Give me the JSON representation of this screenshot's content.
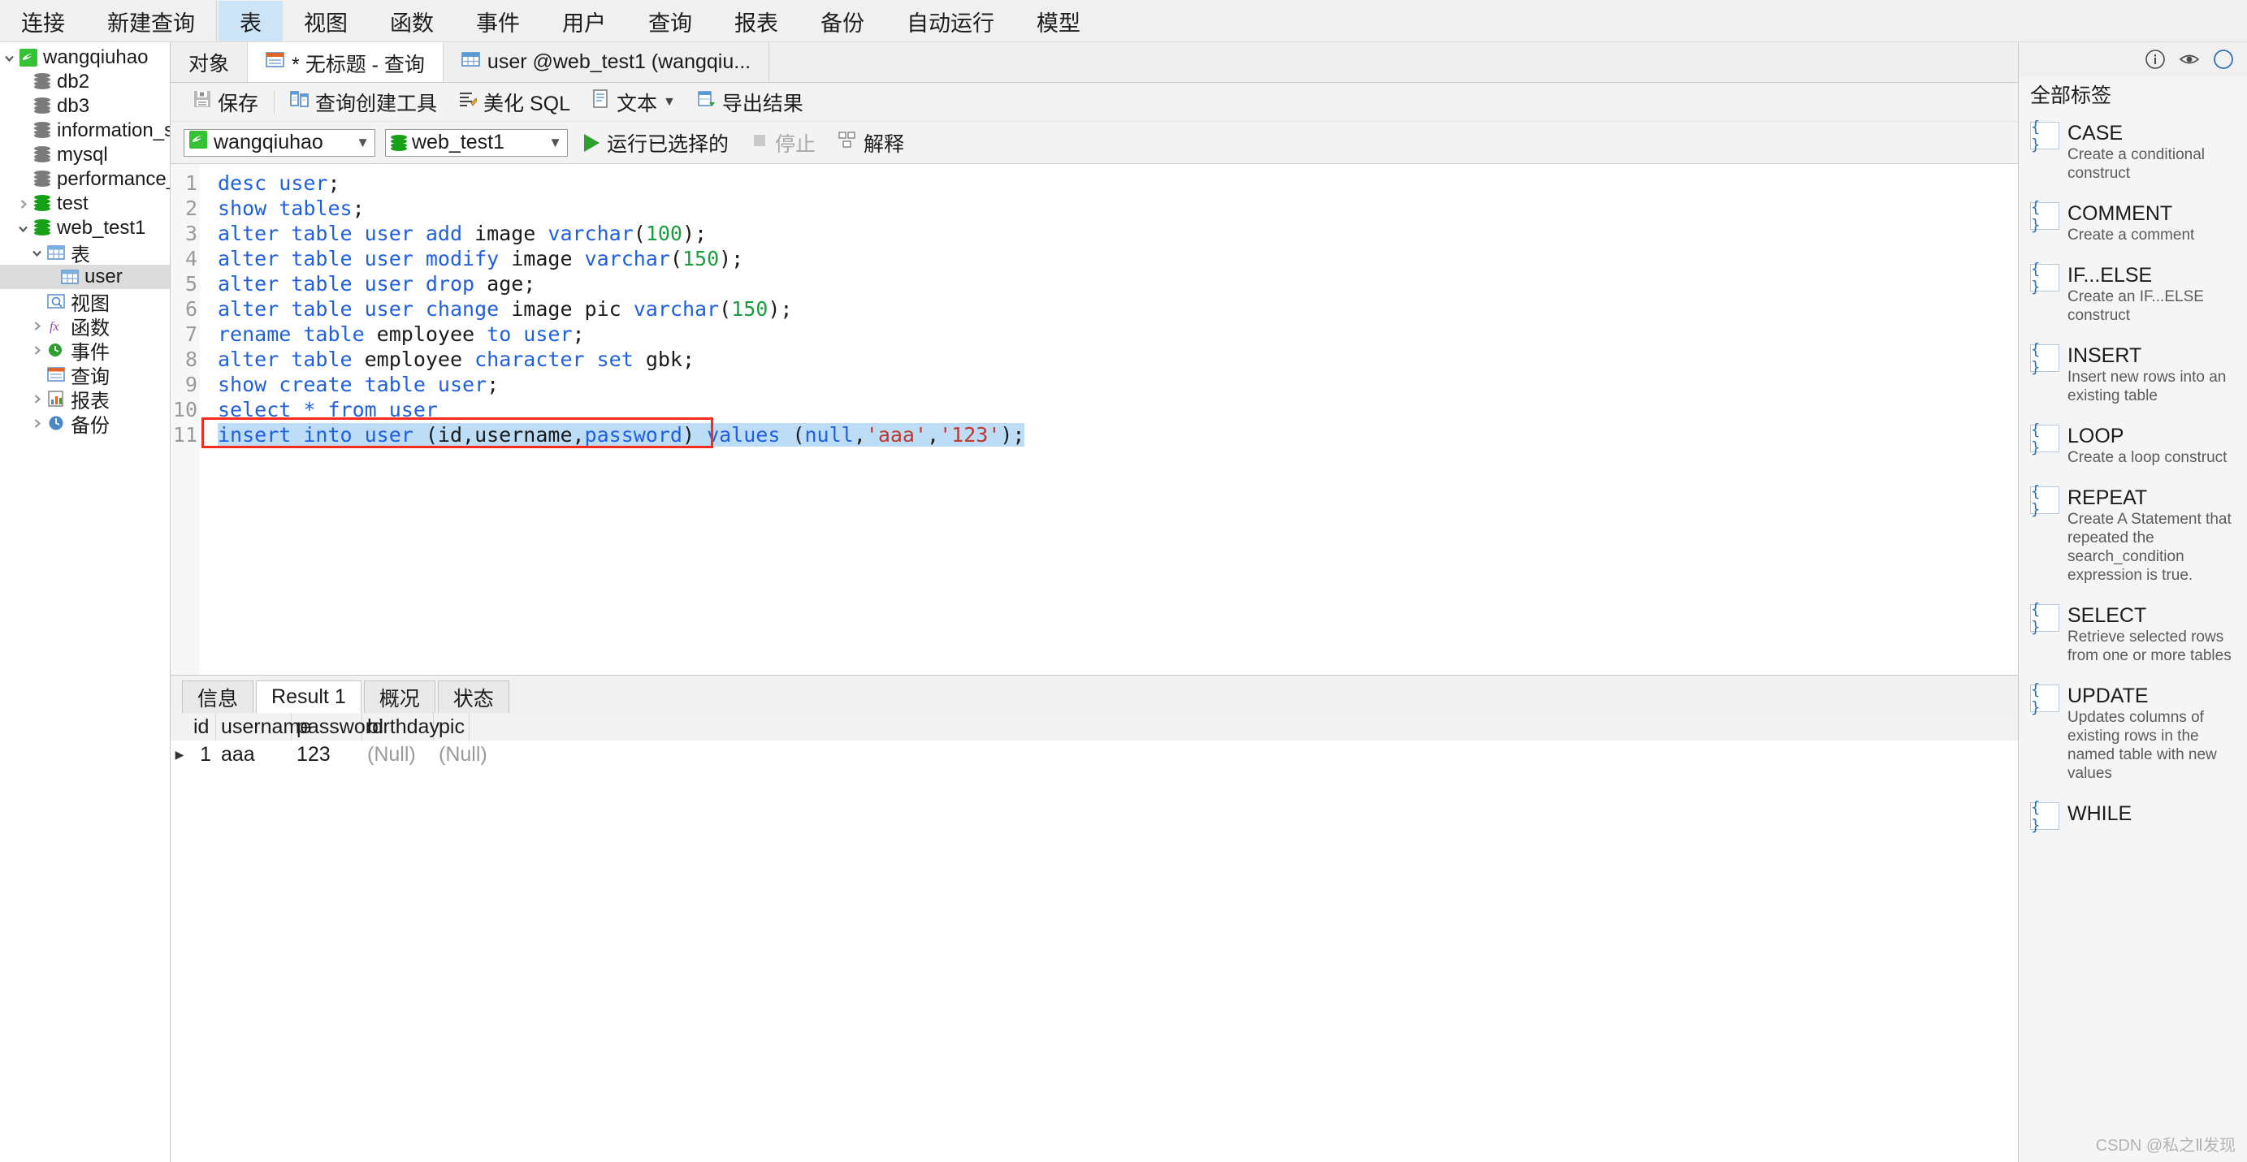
{
  "menubar": {
    "items": [
      {
        "label": "连接",
        "name": "menu-connection",
        "active": false
      },
      {
        "label": "新建查询",
        "name": "menu-new-query",
        "active": false
      },
      {
        "label": "表",
        "name": "menu-table",
        "active": true
      },
      {
        "label": "视图",
        "name": "menu-view",
        "active": false
      },
      {
        "label": "函数",
        "name": "menu-function",
        "active": false
      },
      {
        "label": "事件",
        "name": "menu-event",
        "active": false
      },
      {
        "label": "用户",
        "name": "menu-user",
        "active": false
      },
      {
        "label": "查询",
        "name": "menu-query",
        "active": false
      },
      {
        "label": "报表",
        "name": "menu-report",
        "active": false
      },
      {
        "label": "备份",
        "name": "menu-backup",
        "active": false
      },
      {
        "label": "自动运行",
        "name": "menu-automation",
        "active": false
      },
      {
        "label": "模型",
        "name": "menu-model",
        "active": false
      }
    ]
  },
  "sidebar": {
    "nodes": [
      {
        "label": "wangqiuhao",
        "indent": 0,
        "twist": "open",
        "icon": "connection-icon",
        "selected": false
      },
      {
        "label": "db2",
        "indent": 1,
        "twist": "none",
        "icon": "db-gray-icon",
        "selected": false
      },
      {
        "label": "db3",
        "indent": 1,
        "twist": "none",
        "icon": "db-gray-icon",
        "selected": false
      },
      {
        "label": "information_schema",
        "indent": 1,
        "twist": "none",
        "icon": "db-gray-icon",
        "selected": false
      },
      {
        "label": "mysql",
        "indent": 1,
        "twist": "none",
        "icon": "db-gray-icon",
        "selected": false
      },
      {
        "label": "performance_schema",
        "indent": 1,
        "twist": "none",
        "icon": "db-gray-icon",
        "selected": false
      },
      {
        "label": "test",
        "indent": 1,
        "twist": "closed",
        "icon": "db-green-icon",
        "selected": false
      },
      {
        "label": "web_test1",
        "indent": 1,
        "twist": "open",
        "icon": "db-green-icon",
        "selected": false
      },
      {
        "label": "表",
        "indent": 2,
        "twist": "open",
        "icon": "table-icon",
        "selected": false
      },
      {
        "label": "user",
        "indent": 3,
        "twist": "none",
        "icon": "table-icon",
        "selected": true
      },
      {
        "label": "视图",
        "indent": 2,
        "twist": "none",
        "icon": "view-icon",
        "selected": false
      },
      {
        "label": "函数",
        "indent": 2,
        "twist": "closed",
        "icon": "function-icon",
        "selected": false
      },
      {
        "label": "事件",
        "indent": 2,
        "twist": "closed",
        "icon": "event-icon",
        "selected": false
      },
      {
        "label": "查询",
        "indent": 2,
        "twist": "none",
        "icon": "query-icon",
        "selected": false
      },
      {
        "label": "报表",
        "indent": 2,
        "twist": "closed",
        "icon": "report-icon",
        "selected": false
      },
      {
        "label": "备份",
        "indent": 2,
        "twist": "closed",
        "icon": "backup-icon",
        "selected": false
      }
    ]
  },
  "tabstrip": {
    "object_tab": "对象",
    "tabs": [
      {
        "label": "* 无标题 - 查询",
        "name": "tab-untitled-query",
        "current": true,
        "icon": "query-tab-icon"
      },
      {
        "label": "user @web_test1 (wangqiu...",
        "name": "tab-user-table",
        "current": false,
        "icon": "table-tab-icon"
      }
    ]
  },
  "toolbar": {
    "save": "保存",
    "query_builder": "查询创建工具",
    "beautify_sql": "美化 SQL",
    "text": "文本",
    "export_result": "导出结果"
  },
  "runbar": {
    "connection": "wangqiuhao",
    "database": "web_test1",
    "run_selected": "运行已选择的",
    "stop": "停止",
    "explain": "解释"
  },
  "editor": {
    "lines": [
      {
        "n": "1",
        "tokens": [
          {
            "t": "desc ",
            "c": "kw"
          },
          {
            "t": "user",
            "c": "kw"
          },
          {
            "t": ";",
            "c": "id"
          }
        ]
      },
      {
        "n": "2",
        "tokens": [
          {
            "t": "show tables",
            "c": "kw"
          },
          {
            "t": ";",
            "c": "id"
          }
        ]
      },
      {
        "n": "3",
        "tokens": [
          {
            "t": "alter table user add ",
            "c": "kw"
          },
          {
            "t": "image ",
            "c": "id"
          },
          {
            "t": "varchar",
            "c": "kw"
          },
          {
            "t": "(",
            "c": "id"
          },
          {
            "t": "100",
            "c": "num"
          },
          {
            "t": ");",
            "c": "id"
          }
        ]
      },
      {
        "n": "4",
        "tokens": [
          {
            "t": "alter table user modify ",
            "c": "kw"
          },
          {
            "t": "image ",
            "c": "id"
          },
          {
            "t": "varchar",
            "c": "kw"
          },
          {
            "t": "(",
            "c": "id"
          },
          {
            "t": "150",
            "c": "num"
          },
          {
            "t": ");",
            "c": "id"
          }
        ]
      },
      {
        "n": "5",
        "tokens": [
          {
            "t": "alter table user drop ",
            "c": "kw"
          },
          {
            "t": "age;",
            "c": "id"
          }
        ]
      },
      {
        "n": "6",
        "tokens": [
          {
            "t": "alter table user change ",
            "c": "kw"
          },
          {
            "t": "image pic ",
            "c": "id"
          },
          {
            "t": "varchar",
            "c": "kw"
          },
          {
            "t": "(",
            "c": "id"
          },
          {
            "t": "150",
            "c": "num"
          },
          {
            "t": ");",
            "c": "id"
          }
        ]
      },
      {
        "n": "7",
        "tokens": [
          {
            "t": "rename table ",
            "c": "kw"
          },
          {
            "t": "employee ",
            "c": "id"
          },
          {
            "t": "to user",
            "c": "kw"
          },
          {
            "t": ";",
            "c": "id"
          }
        ]
      },
      {
        "n": "8",
        "tokens": [
          {
            "t": "alter table ",
            "c": "kw"
          },
          {
            "t": "employee ",
            "c": "id"
          },
          {
            "t": "character set ",
            "c": "kw"
          },
          {
            "t": "gbk;",
            "c": "id"
          }
        ]
      },
      {
        "n": "9",
        "tokens": [
          {
            "t": "show create table user",
            "c": "kw"
          },
          {
            "t": ";",
            "c": "id"
          }
        ]
      },
      {
        "n": "10",
        "tokens": [
          {
            "t": "select * from user",
            "c": "kw"
          }
        ]
      },
      {
        "n": "11",
        "tokens": [
          {
            "t": "insert into user ",
            "c": "kw"
          },
          {
            "t": "(id,username,",
            "c": "id"
          },
          {
            "t": "password",
            "c": "kw"
          },
          {
            "t": ") ",
            "c": "id"
          },
          {
            "t": "values ",
            "c": "kw"
          },
          {
            "t": "(",
            "c": "id"
          },
          {
            "t": "null",
            "c": "kw"
          },
          {
            "t": ",",
            "c": "id"
          },
          {
            "t": "'aaa'",
            "c": "str"
          },
          {
            "t": ",",
            "c": "id"
          },
          {
            "t": "'123'",
            "c": "str"
          },
          {
            "t": ");",
            "c": "id"
          }
        ],
        "selected": true,
        "annotated": true
      }
    ]
  },
  "results": {
    "tabs": [
      {
        "label": "信息",
        "name": "result-tab-info",
        "active": false
      },
      {
        "label": "Result 1",
        "name": "result-tab-result1",
        "active": true
      },
      {
        "label": "概况",
        "name": "result-tab-profile",
        "active": false
      },
      {
        "label": "状态",
        "name": "result-tab-status",
        "active": false
      }
    ],
    "columns": [
      "id",
      "username",
      "password",
      "birthday",
      "pic"
    ],
    "rows": [
      {
        "id": "1",
        "username": "aaa",
        "password": "123",
        "birthday": "(Null)",
        "pic": "(Null)"
      }
    ]
  },
  "rightpanel": {
    "title": "全部标签",
    "snippets": [
      {
        "name": "CASE",
        "desc": "Create a conditional construct"
      },
      {
        "name": "COMMENT",
        "desc": "Create a comment"
      },
      {
        "name": "IF...ELSE",
        "desc": "Create an IF...ELSE construct"
      },
      {
        "name": "INSERT",
        "desc": "Insert new rows into an existing table"
      },
      {
        "name": "LOOP",
        "desc": "Create a loop construct"
      },
      {
        "name": "REPEAT",
        "desc": "Create A Statement that repeated the search_condition expression is true."
      },
      {
        "name": "SELECT",
        "desc": "Retrieve selected rows from one or more tables"
      },
      {
        "name": "UPDATE",
        "desc": "Updates columns of existing rows in the named table with new values"
      },
      {
        "name": "WHILE",
        "desc": ""
      }
    ]
  },
  "watermark": "CSDN @私之Ⅱ发现"
}
